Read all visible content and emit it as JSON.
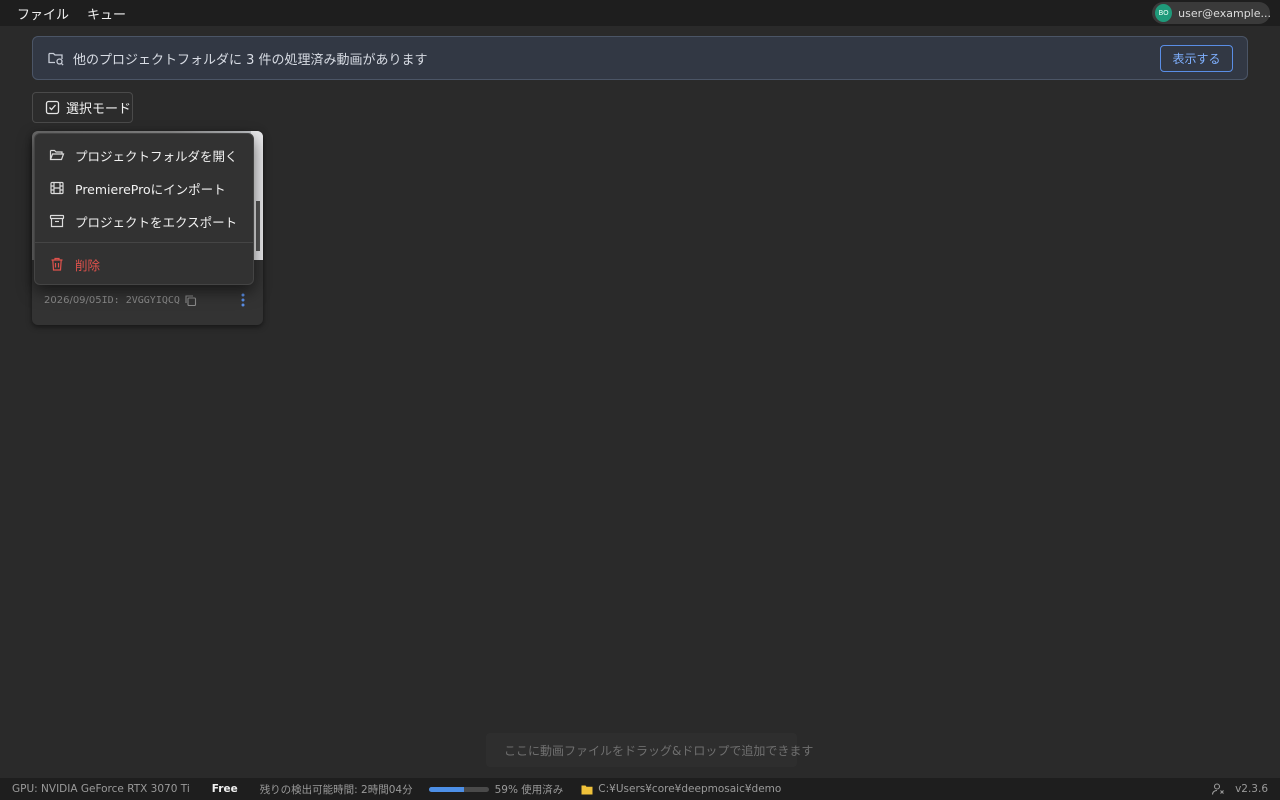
{
  "menubar": {
    "items": [
      "ファイル",
      "キュー"
    ],
    "user": {
      "initials": "BO",
      "email": "user@example...."
    }
  },
  "banner": {
    "message": "他のプロジェクトフォルダに 3 件の処理済み動画があります",
    "button": "表示する",
    "accent": "#5a8ee6"
  },
  "toolbar": {
    "select_mode": "選択モード"
  },
  "card": {
    "title": "",
    "date": "2026/09/05",
    "id": "ID: 2VGGYIQCQ"
  },
  "context_menu": {
    "items": [
      {
        "label": "プロジェクトフォルダを開く",
        "icon": "folder-open-icon"
      },
      {
        "label": "PremiereProにインポート",
        "icon": "film-icon"
      },
      {
        "label": "プロジェクトをエクスポート",
        "icon": "archive-icon"
      }
    ],
    "danger": {
      "label": "削除",
      "icon": "trash-icon",
      "color": "#e0524c"
    }
  },
  "drop_hint": "ここに動画ファイルをドラッグ&ドロップで追加できます",
  "statusbar": {
    "gpu": "GPU: NVIDIA GeForce RTX 3070 Ti",
    "plan": "Free",
    "remaining": "残りの検出可能時間: 2時間04分",
    "usage_percent": 59,
    "usage_label": "59% 使用済み",
    "path": "C:¥Users¥core¥deepmosaic¥demo",
    "version": "v2.3.6"
  }
}
